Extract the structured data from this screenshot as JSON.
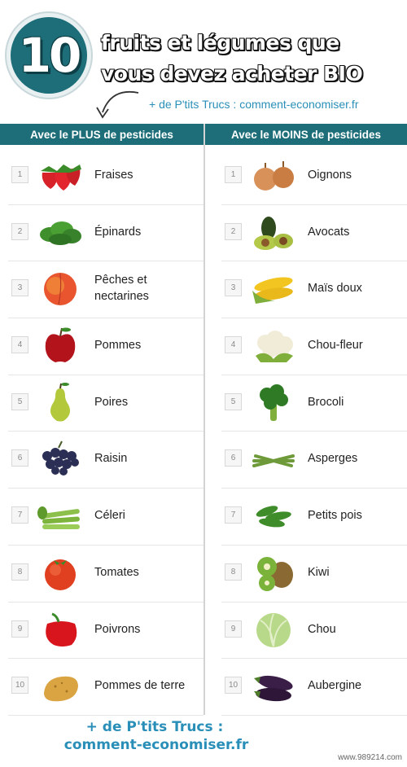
{
  "header": {
    "number": "10",
    "title_line1": "fruits et légumes que",
    "title_line2": "vous devez acheter BIO",
    "link": "+ de P'tits Trucs : comment-economiser.fr"
  },
  "columns": {
    "left_title": "Avec le PLUS de pesticides",
    "right_title": "Avec le MOINS de pesticides"
  },
  "left_items": [
    {
      "num": "1",
      "label": "Fraises",
      "icon": "strawberry-icon"
    },
    {
      "num": "2",
      "label": "Épinards",
      "icon": "spinach-icon"
    },
    {
      "num": "3",
      "label": "Pêches et nectarines",
      "icon": "peach-icon"
    },
    {
      "num": "4",
      "label": "Pommes",
      "icon": "apple-icon"
    },
    {
      "num": "5",
      "label": "Poires",
      "icon": "pear-icon"
    },
    {
      "num": "6",
      "label": "Raisin",
      "icon": "grapes-icon"
    },
    {
      "num": "7",
      "label": "Céleri",
      "icon": "celery-icon"
    },
    {
      "num": "8",
      "label": "Tomates",
      "icon": "tomato-icon"
    },
    {
      "num": "9",
      "label": "Poivrons",
      "icon": "bell-pepper-icon"
    },
    {
      "num": "10",
      "label": "Pommes de terre",
      "icon": "potato-icon"
    }
  ],
  "right_items": [
    {
      "num": "1",
      "label": "Oignons",
      "icon": "onion-icon"
    },
    {
      "num": "2",
      "label": "Avocats",
      "icon": "avocado-icon"
    },
    {
      "num": "3",
      "label": "Maïs doux",
      "icon": "corn-icon"
    },
    {
      "num": "4",
      "label": "Chou-fleur",
      "icon": "cauliflower-icon"
    },
    {
      "num": "5",
      "label": "Brocoli",
      "icon": "broccoli-icon"
    },
    {
      "num": "6",
      "label": "Asperges",
      "icon": "asparagus-icon"
    },
    {
      "num": "7",
      "label": "Petits pois",
      "icon": "peas-icon"
    },
    {
      "num": "8",
      "label": "Kiwi",
      "icon": "kiwi-icon"
    },
    {
      "num": "9",
      "label": "Chou",
      "icon": "cabbage-icon"
    },
    {
      "num": "10",
      "label": "Aubergine",
      "icon": "eggplant-icon"
    }
  ],
  "footer": {
    "line1": "+ de P'tits Trucs :",
    "line2": "comment-economiser.fr"
  },
  "watermark": "www.989214.com",
  "colors": {
    "header_teal": "#1d6e79",
    "link_blue": "#2a8fb8"
  }
}
